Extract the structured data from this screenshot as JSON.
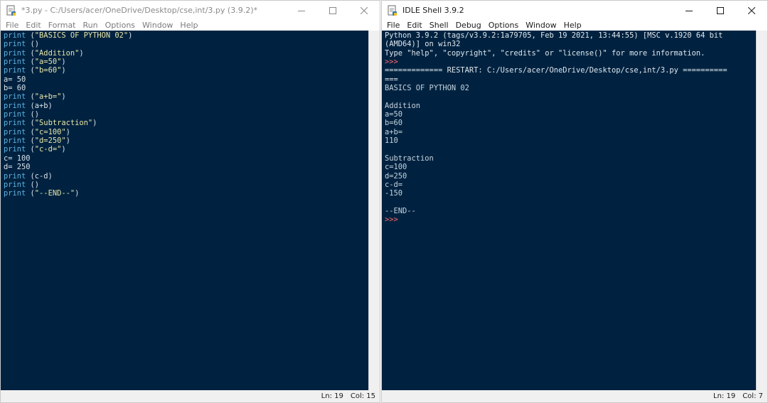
{
  "editor": {
    "title": "*3.py - C:/Users/acer/OneDrive/Desktop/cse,int/3.py (3.9.2)*",
    "menu": [
      "File",
      "Edit",
      "Format",
      "Run",
      "Options",
      "Window",
      "Help"
    ],
    "code_lines": [
      [
        {
          "t": "print",
          "c": "kw"
        },
        {
          "t": " (",
          "c": "plain"
        },
        {
          "t": "\"BASICS OF PYTHON 02\"",
          "c": "str"
        },
        {
          "t": ")",
          "c": "plain"
        }
      ],
      [
        {
          "t": "print",
          "c": "kw"
        },
        {
          "t": " ()",
          "c": "plain"
        }
      ],
      [
        {
          "t": "print",
          "c": "kw"
        },
        {
          "t": " (",
          "c": "plain"
        },
        {
          "t": "\"Addition\"",
          "c": "str"
        },
        {
          "t": ")",
          "c": "plain"
        }
      ],
      [
        {
          "t": "print",
          "c": "kw"
        },
        {
          "t": " (",
          "c": "plain"
        },
        {
          "t": "\"a=50\"",
          "c": "str"
        },
        {
          "t": ")",
          "c": "plain"
        }
      ],
      [
        {
          "t": "print",
          "c": "kw"
        },
        {
          "t": " (",
          "c": "plain"
        },
        {
          "t": "\"b=60\"",
          "c": "str"
        },
        {
          "t": ")",
          "c": "plain"
        }
      ],
      [
        {
          "t": "a= 50",
          "c": "plain"
        }
      ],
      [
        {
          "t": "b= 60",
          "c": "plain"
        }
      ],
      [
        {
          "t": "print",
          "c": "kw"
        },
        {
          "t": " (",
          "c": "plain"
        },
        {
          "t": "\"a+b=\"",
          "c": "str"
        },
        {
          "t": ")",
          "c": "plain"
        }
      ],
      [
        {
          "t": "print",
          "c": "kw"
        },
        {
          "t": " (a+b)",
          "c": "plain"
        }
      ],
      [
        {
          "t": "print",
          "c": "kw"
        },
        {
          "t": " ()",
          "c": "plain"
        }
      ],
      [
        {
          "t": "print",
          "c": "kw"
        },
        {
          "t": " (",
          "c": "plain"
        },
        {
          "t": "\"Subtraction\"",
          "c": "str"
        },
        {
          "t": ")",
          "c": "plain"
        }
      ],
      [
        {
          "t": "print",
          "c": "kw"
        },
        {
          "t": " (",
          "c": "plain"
        },
        {
          "t": "\"c=100\"",
          "c": "str"
        },
        {
          "t": ")",
          "c": "plain"
        }
      ],
      [
        {
          "t": "print",
          "c": "kw"
        },
        {
          "t": " (",
          "c": "plain"
        },
        {
          "t": "\"d=250\"",
          "c": "str"
        },
        {
          "t": ")",
          "c": "plain"
        }
      ],
      [
        {
          "t": "print",
          "c": "kw"
        },
        {
          "t": " (",
          "c": "plain"
        },
        {
          "t": "\"c-d=\"",
          "c": "str"
        },
        {
          "t": ")",
          "c": "plain"
        }
      ],
      [
        {
          "t": "c= 100",
          "c": "plain"
        }
      ],
      [
        {
          "t": "d= 250",
          "c": "plain"
        }
      ],
      [
        {
          "t": "print",
          "c": "kw"
        },
        {
          "t": " (c-d)",
          "c": "plain"
        }
      ],
      [
        {
          "t": "print",
          "c": "kw"
        },
        {
          "t": " ()",
          "c": "plain"
        }
      ],
      [
        {
          "t": "print",
          "c": "kw"
        },
        {
          "t": " (",
          "c": "plain"
        },
        {
          "t": "\"--END--\"",
          "c": "str"
        },
        {
          "t": ")",
          "c": "plain"
        }
      ]
    ],
    "status": {
      "ln": "Ln: 19",
      "col": "Col: 15"
    }
  },
  "shell": {
    "title": "IDLE Shell 3.9.2",
    "menu": [
      "File",
      "Edit",
      "Shell",
      "Debug",
      "Options",
      "Window",
      "Help"
    ],
    "lines": [
      {
        "t": "Python 3.9.2 (tags/v3.9.2:1a79705, Feb 19 2021, 13:44:55) [MSC v.1920 64 bit",
        "c": "info"
      },
      {
        "t": "(AMD64)] on win32",
        "c": "info"
      },
      {
        "t": "Type \"help\", \"copyright\", \"credits\" or \"license()\" for more information.",
        "c": "info"
      },
      {
        "t": ">>> ",
        "c": "prompt"
      },
      {
        "t": "============= RESTART: C:/Users/acer/OneDrive/Desktop/cse,int/3.py ==========",
        "c": "info"
      },
      {
        "t": "===",
        "c": "info"
      },
      {
        "t": "BASICS OF PYTHON 02",
        "c": "out"
      },
      {
        "t": "",
        "c": "out"
      },
      {
        "t": "Addition",
        "c": "out"
      },
      {
        "t": "a=50",
        "c": "out"
      },
      {
        "t": "b=60",
        "c": "out"
      },
      {
        "t": "a+b=",
        "c": "out"
      },
      {
        "t": "110",
        "c": "out"
      },
      {
        "t": "",
        "c": "out"
      },
      {
        "t": "Subtraction",
        "c": "out"
      },
      {
        "t": "c=100",
        "c": "out"
      },
      {
        "t": "d=250",
        "c": "out"
      },
      {
        "t": "c-d=",
        "c": "out"
      },
      {
        "t": "-150",
        "c": "out"
      },
      {
        "t": "",
        "c": "out"
      },
      {
        "t": "--END--",
        "c": "out"
      },
      {
        "t": ">>> ",
        "c": "prompt"
      }
    ],
    "status": {
      "ln": "Ln: 19",
      "col": "Col: 7"
    }
  },
  "colors": {
    "editor_bg": "#002240",
    "keyword": "#5fb3e0",
    "string": "#e8e6a8",
    "prompt": "#ff6a6a",
    "output": "#c5d3de"
  },
  "icons": {
    "app": "python-idle-icon",
    "minimize": "minimize-icon",
    "maximize": "maximize-icon",
    "close": "close-icon"
  }
}
